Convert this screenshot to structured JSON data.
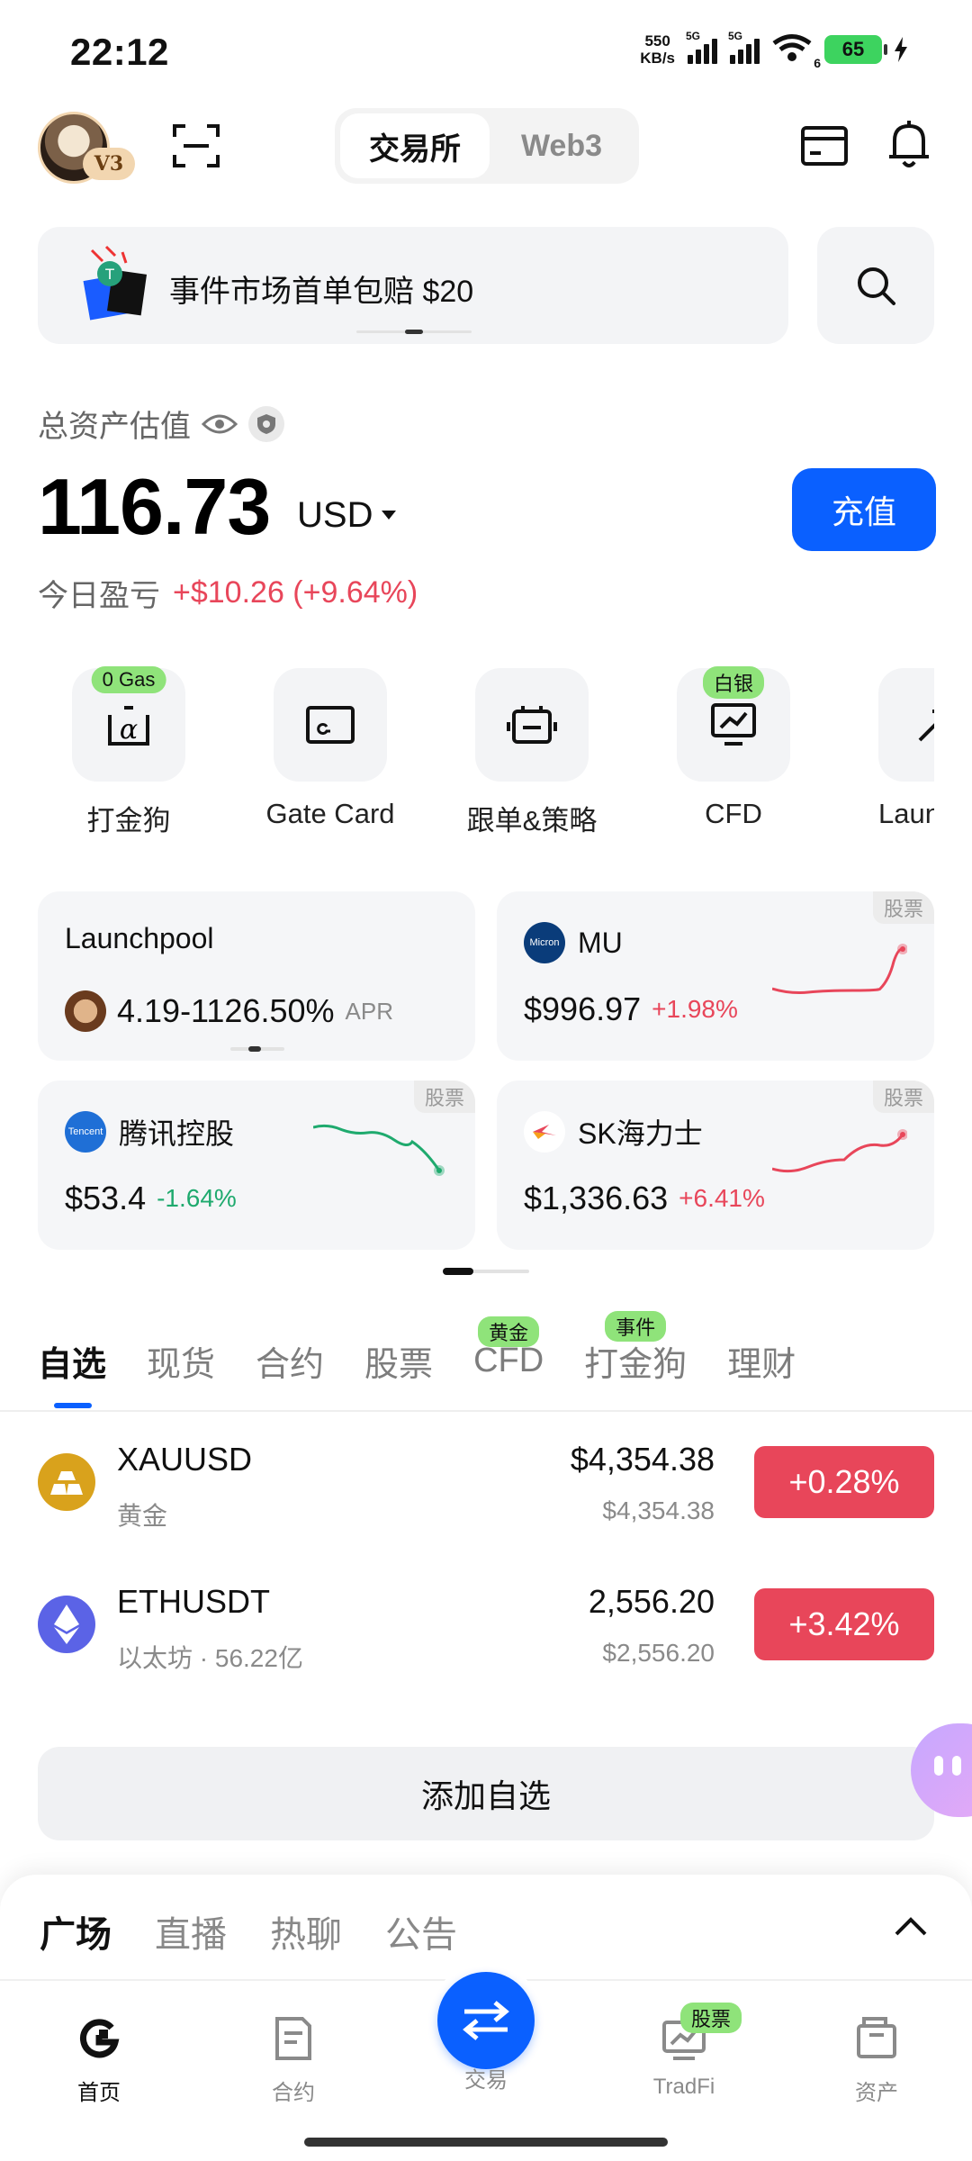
{
  "status_bar": {
    "time": "22:12",
    "net_speed_value": "550",
    "net_speed_unit": "KB/s",
    "signal_1_tag": "5G",
    "signal_2_tag": "5G",
    "wifi_tag": "6",
    "battery": "65"
  },
  "header": {
    "level_badge": "V3",
    "tabs": [
      {
        "label": "交易所",
        "active": true
      },
      {
        "label": "Web3",
        "active": false
      }
    ]
  },
  "banner": {
    "text": "事件市场首单包赔 $20"
  },
  "assets": {
    "label": "总资产估值",
    "balance": "116.73",
    "currency": "USD",
    "deposit_label": "充值",
    "pnl_label": "今日盈亏",
    "pnl_value": "+$10.26 (+9.64%)"
  },
  "quick_actions": [
    {
      "label": "打金狗",
      "badge": "0 Gas",
      "icon": "alpha-icon"
    },
    {
      "label": "Gate Card",
      "badge": "",
      "icon": "card-icon"
    },
    {
      "label": "跟单&策略",
      "badge": "",
      "icon": "robot-icon"
    },
    {
      "label": "CFD",
      "badge": "白银",
      "icon": "chart-monitor-icon"
    },
    {
      "label": "Launc",
      "badge": "",
      "icon": "launch-icon"
    }
  ],
  "market_cards": [
    {
      "title": "Launchpool",
      "value": "4.19-1126.50%",
      "suffix": "APR",
      "tag": ""
    },
    {
      "title": "MU",
      "price": "$996.97",
      "change": "+1.98%",
      "tag": "股票",
      "logo_text": "Micron",
      "trend": "up"
    },
    {
      "title": "腾讯控股",
      "price": "$53.4",
      "change": "-1.64%",
      "tag": "股票",
      "logo_text": "Tencent",
      "trend": "down"
    },
    {
      "title": "SK海力士",
      "price": "$1,336.63",
      "change": "+6.41%",
      "tag": "股票",
      "logo_text": "",
      "trend": "up"
    }
  ],
  "tabs": [
    {
      "label": "自选",
      "active": true,
      "badge": ""
    },
    {
      "label": "现货",
      "active": false,
      "badge": ""
    },
    {
      "label": "合约",
      "active": false,
      "badge": ""
    },
    {
      "label": "股票",
      "active": false,
      "badge": ""
    },
    {
      "label": "CFD",
      "active": false,
      "badge": "黄金"
    },
    {
      "label": "打金狗",
      "active": false,
      "badge": "事件"
    },
    {
      "label": "理财",
      "active": false,
      "badge": ""
    }
  ],
  "watchlist": [
    {
      "symbol": "XAUUSD",
      "name": "黄金",
      "price": "$4,354.38",
      "price_sub": "$4,354.38",
      "change": "+0.28%"
    },
    {
      "symbol": "ETHUSDT",
      "name": "以太坊 · 56.22亿",
      "price": "2,556.20",
      "price_sub": "$2,556.20",
      "change": "+3.42%"
    }
  ],
  "add_watch_label": "添加自选",
  "feed_tabs": [
    {
      "label": "广场",
      "active": true
    },
    {
      "label": "直播",
      "active": false
    },
    {
      "label": "热聊",
      "active": false
    },
    {
      "label": "公告",
      "active": false
    }
  ],
  "bottom_nav": [
    {
      "label": "首页",
      "active": true
    },
    {
      "label": "合约",
      "active": false
    },
    {
      "label": "交易",
      "active": false
    },
    {
      "label": "TradFi",
      "active": false,
      "badge": "股票"
    },
    {
      "label": "资产",
      "active": false
    }
  ],
  "colors": {
    "accent": "#0a60ff",
    "up": "#e8465a",
    "down": "#1faa6e",
    "badge": "#8fe37a"
  }
}
